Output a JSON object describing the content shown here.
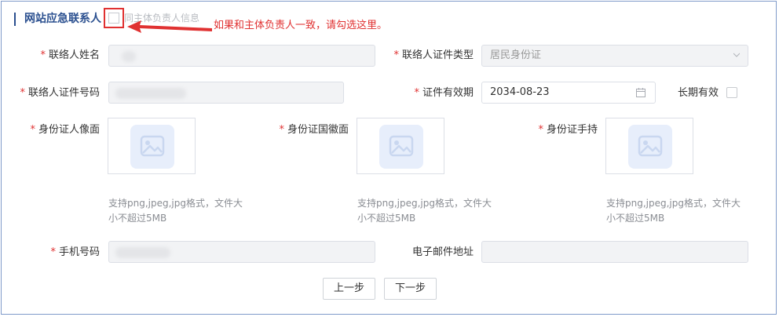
{
  "section": {
    "title": "网站应急联系人",
    "same_as_owner_label": "同主体负责人信息",
    "annotation_hint": "如果和主体负责人一致，请勾选这里。"
  },
  "form": {
    "contact_name_label": "联络人姓名",
    "id_type_label": "联络人证件类型",
    "id_type_value": "居民身份证",
    "id_number_label": "联络人证件号码",
    "validity_label": "证件有效期",
    "validity_value": "2034-08-23",
    "long_term_label": "长期有效",
    "id_front_label": "身份证人像面",
    "id_back_label": "身份证国徽面",
    "id_hand_label": "身份证手持",
    "upload_tip_line1": "支持png,jpeg,jpg格式，文件大",
    "upload_tip_line2": "小不超过5MB",
    "phone_label": "手机号码",
    "email_label": "电子邮件地址",
    "required_mark": "*"
  },
  "buttons": {
    "prev": "上一步",
    "next": "下一步"
  },
  "icons": {
    "chevron": "chevron-down-icon",
    "calendar": "calendar-icon",
    "image": "image-placeholder-icon"
  },
  "colors": {
    "accent": "#2a4f8f",
    "annotation_red": "#e03131",
    "required_red": "#e03131"
  }
}
